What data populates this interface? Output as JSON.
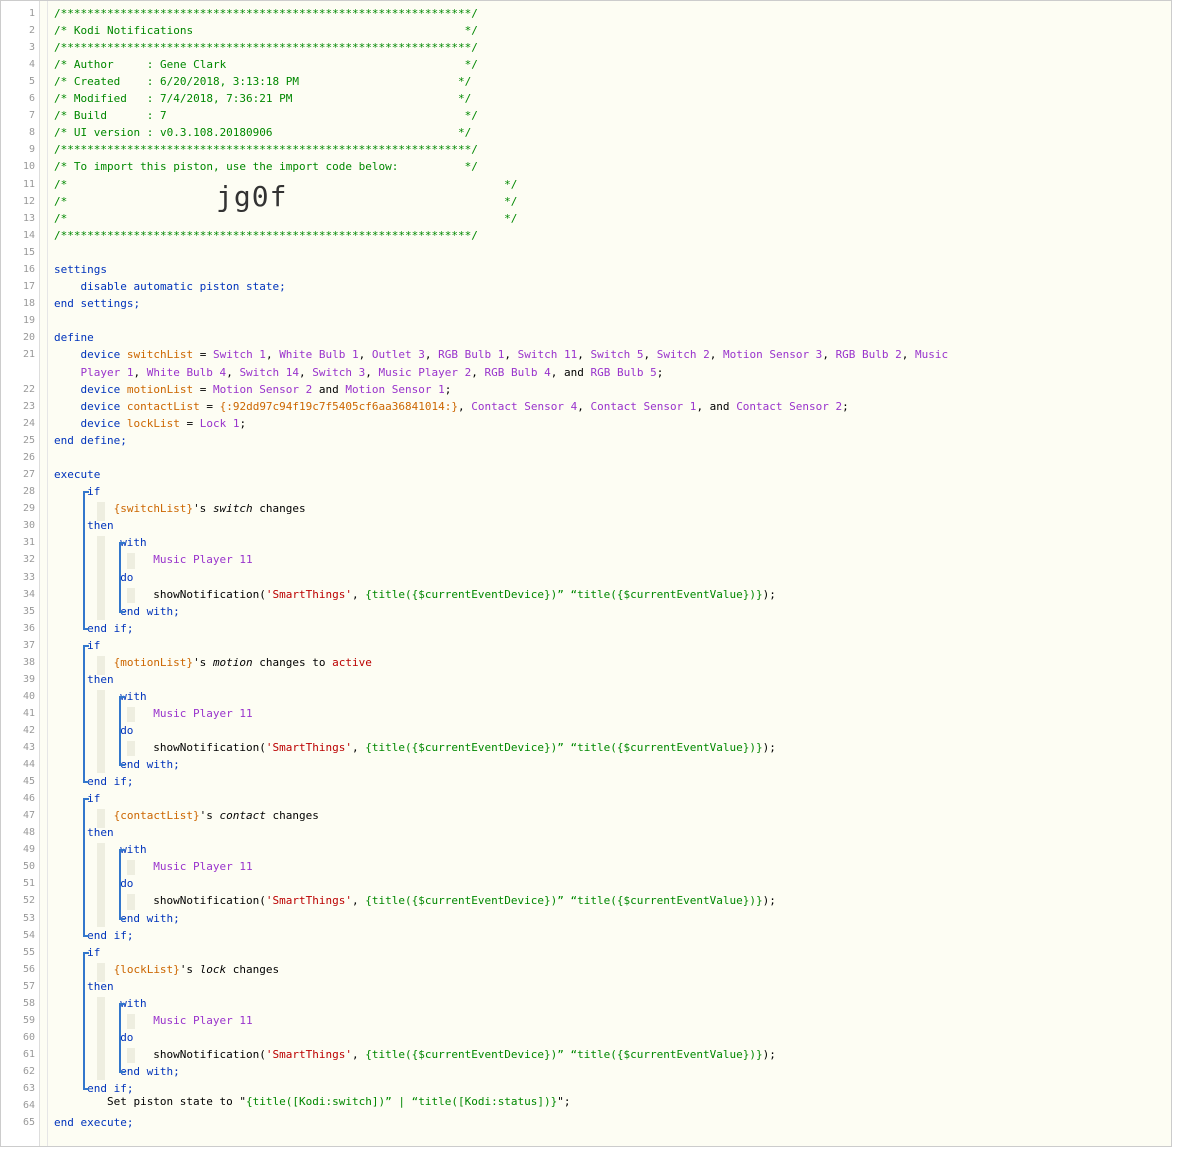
{
  "title_box": {
    "border": "/**************************************************************/",
    "title": "/* Kodi Notifications                                         */",
    "author": "/* Author     : Gene Clark                                    */",
    "created": "/* Created    : 6/20/2018, 3:13:18 PM                        */",
    "modified": "/* Modified   : 7/4/2018, 7:36:21 PM                         */",
    "build": "/* Build      : 7                                             */",
    "ui_version": "/* UI version : v0.3.108.20180906                            */",
    "import_note": "/* To import this piston, use the import code below:          */",
    "blank_left": "/*",
    "blank_right": "*/",
    "import_code": "jg0f"
  },
  "settings": {
    "open": "settings",
    "body": "disable automatic piston state;",
    "close": "end settings;"
  },
  "define": {
    "open": "define",
    "close": "end define;",
    "kw_device": "device",
    "eq": " = ",
    "switchList": {
      "name": "switchList",
      "devices_line1": [
        "Switch 1",
        "White Bulb 1",
        "Outlet 3",
        "RGB Bulb 1",
        "Switch 11",
        "Switch 5",
        "Switch 2",
        "Motion Sensor 3",
        "RGB Bulb 2",
        "Music"
      ],
      "devices_line2": [
        "Player 1",
        "White Bulb 4",
        "Switch 14",
        "Switch 3",
        "Music Player 2",
        "RGB Bulb 4"
      ],
      "last": "RGB Bulb 5"
    },
    "motionList": {
      "name": "motionList",
      "a": "Motion Sensor 2",
      "b": "Motion Sensor 1"
    },
    "contactList": {
      "name": "contactList",
      "expr": "{:92dd97c94f19c7f5405cf6aa36841014:}",
      "a": "Contact Sensor 4",
      "b": "Contact Sensor 1",
      "c": "Contact Sensor 2"
    },
    "lockList": {
      "name": "lockList",
      "a": "Lock 1"
    }
  },
  "execute": {
    "open": "execute",
    "close": "end execute;",
    "kw_if": "if",
    "kw_then": "then",
    "kw_with": "with",
    "kw_do": "do",
    "kw_end_with": "end with;",
    "kw_end_if": "end if;",
    "device": "Music Player 11",
    "action": {
      "fn": "showNotification(",
      "arg1": "'SmartThings'",
      "sep": ", ",
      "arg2": "{title({$currentEventDevice})” “title({$currentEventValue})}",
      "end": ");"
    },
    "blocks": [
      {
        "var": "{switchList}",
        "mid": "'s ",
        "attr": "switch",
        "op": " changes",
        "val": ""
      },
      {
        "var": "{motionList}",
        "mid": "'s ",
        "attr": "motion",
        "op": " changes to ",
        "val": "active"
      },
      {
        "var": "{contactList}",
        "mid": "'s ",
        "attr": "contact",
        "op": " changes",
        "val": ""
      },
      {
        "var": "{lockList}",
        "mid": "'s ",
        "attr": "lock",
        "op": " changes",
        "val": ""
      }
    ],
    "final": {
      "pre": "Set piston state to \"",
      "expr": "{title([Kodi:switch])” | “title([Kodi:status])}",
      "post": "\";"
    }
  },
  "colors": {
    "comment": "#008800",
    "keyword": "#0033bb",
    "variable": "#cc6600",
    "device": "#9933cc",
    "string": "#bb0000",
    "block_bar": "#3377cc"
  }
}
